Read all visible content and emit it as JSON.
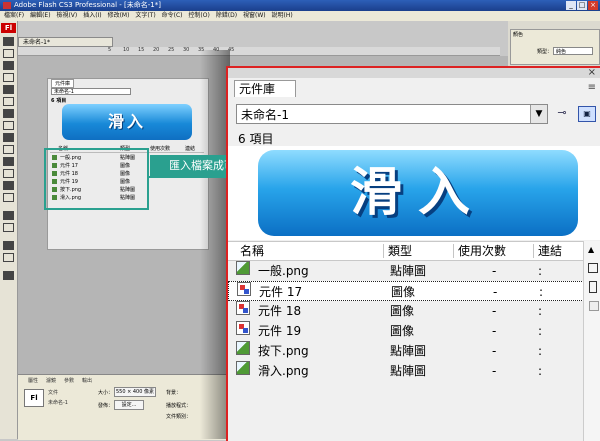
{
  "titlebar": {
    "title": "Adobe Flash CS3 Professional - [未命名-1*]"
  },
  "menus": [
    "檔案(F)",
    "編輯(E)",
    "檢視(V)",
    "插入(I)",
    "修改(M)",
    "文字(T)",
    "命令(C)",
    "控制(O)",
    "除錯(D)",
    "視窗(W)",
    "說明(H)"
  ],
  "toolbar": {
    "logo": "Fl"
  },
  "document": {
    "tab_label": "未命名-1*"
  },
  "timeline": {
    "ruler": [
      "5",
      "10",
      "15",
      "20",
      "25",
      "30",
      "35",
      "40",
      "45",
      "50",
      "55",
      "60",
      "65",
      "70",
      "75",
      "80",
      "85",
      "90",
      "95"
    ]
  },
  "properties": {
    "tabs": [
      "屬性",
      "濾鏡",
      "參數",
      "輸出"
    ],
    "icon": "Fl",
    "doc_label": "文件",
    "doc_name": "未命名-1",
    "size_label": "大小：",
    "size_value": "550 × 400 像素",
    "publish_label": "發佈：",
    "settings_button": "設定...",
    "bg_label": "背景：",
    "player_label": "播放程式：",
    "class_label": "文件類別："
  },
  "color_panel": {
    "tab": "顏色",
    "type_label": "類型：",
    "type_value": "純色"
  },
  "small_library": {
    "tab": "元件庫",
    "selector": "未命名-1",
    "count": "6 項目",
    "banner": "滑入",
    "headers": [
      "名稱",
      "類型",
      "使用次數",
      "連結"
    ],
    "rows": [
      {
        "name": "一般.png",
        "type": "點陣圖"
      },
      {
        "name": "元件 17",
        "type": "圖像"
      },
      {
        "name": "元件 18",
        "type": "圖像"
      },
      {
        "name": "元件 19",
        "type": "圖像"
      },
      {
        "name": "按下.png",
        "type": "點陣圖"
      },
      {
        "name": "滑入.png",
        "type": "點陣圖"
      }
    ]
  },
  "callout": {
    "text": "匯入檔案成可使用「元件」"
  },
  "library": {
    "tab": "元件庫",
    "close": "×",
    "options": "≡",
    "selector": "未命名-1",
    "count": "6 項目",
    "banner": "滑入",
    "headers": {
      "name": "名稱",
      "type": "類型",
      "use": "使用次數",
      "link": "連結"
    },
    "rows": [
      {
        "name": "一般.png",
        "type": "點陣圖",
        "use": "-",
        "link": ":",
        "icon": "bitmap-icon"
      },
      {
        "name": "元件 17",
        "type": "圖像",
        "use": "-",
        "link": ":",
        "icon": "graphic-icon"
      },
      {
        "name": "元件 18",
        "type": "圖像",
        "use": "-",
        "link": ":",
        "icon": "graphic-icon"
      },
      {
        "name": "元件 19",
        "type": "圖像",
        "use": "-",
        "link": ":",
        "icon": "graphic-icon"
      },
      {
        "name": "按下.png",
        "type": "點陣圖",
        "use": "-",
        "link": ":",
        "icon": "bitmap-icon"
      },
      {
        "name": "滑入.png",
        "type": "點陣圖",
        "use": "-",
        "link": ":",
        "icon": "bitmap-icon"
      }
    ]
  },
  "colors": {
    "accent": "#2aa08f",
    "highlight_border": "#dd2222",
    "banner_blue": "#1889d8"
  }
}
